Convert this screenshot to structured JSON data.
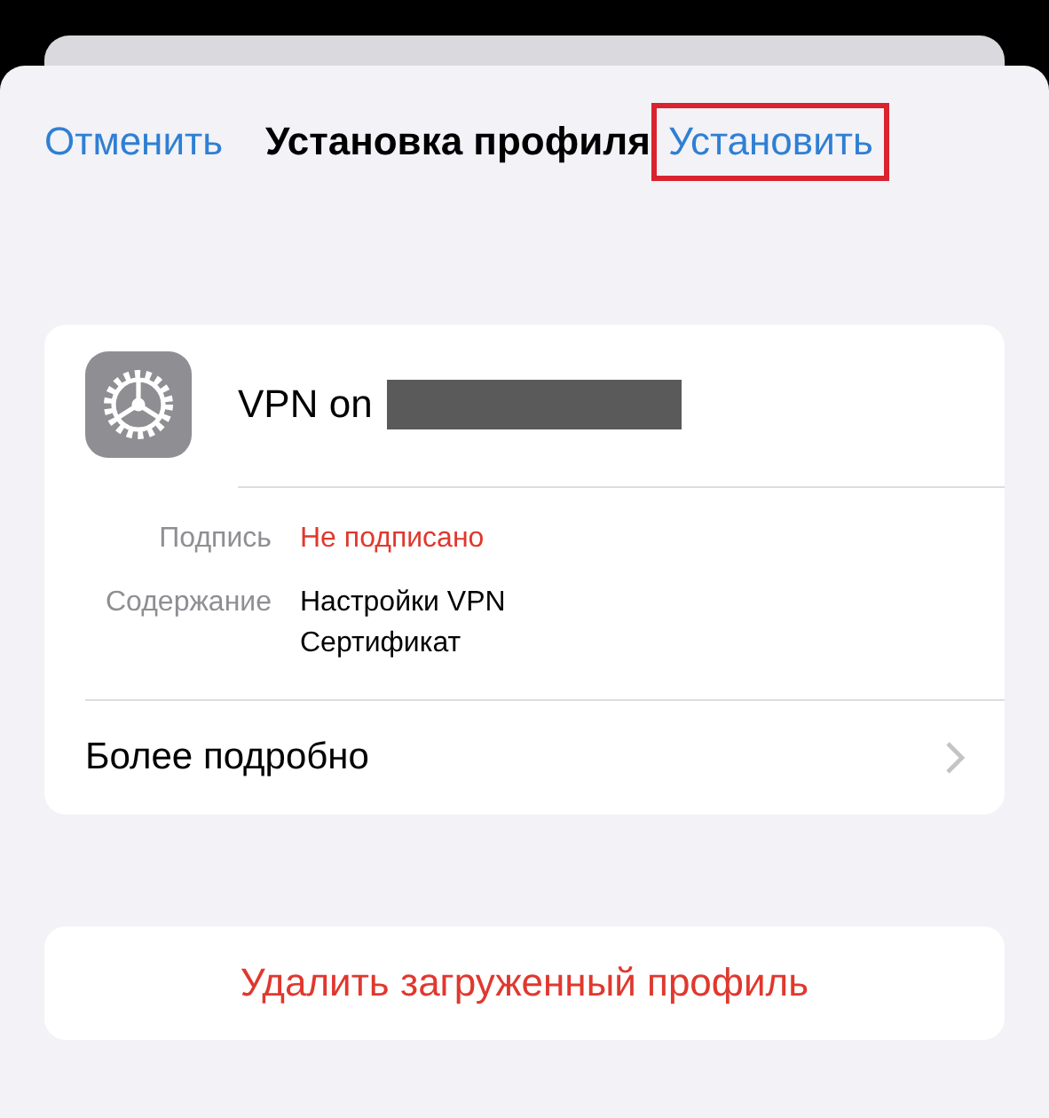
{
  "nav": {
    "cancel": "Отменить",
    "title": "Установка профиля",
    "install": "Установить",
    "install_highlighted": true
  },
  "profile": {
    "name": "VPN on",
    "name_redacted": true,
    "details": [
      {
        "label": "Подпись",
        "values": [
          "Не подписано"
        ],
        "kind": "warning"
      },
      {
        "label": "Содержание",
        "values": [
          "Настройки VPN",
          "Сертификат"
        ],
        "kind": "normal"
      }
    ],
    "more": "Более подробно"
  },
  "remove": "Удалить загруженный профиль"
}
